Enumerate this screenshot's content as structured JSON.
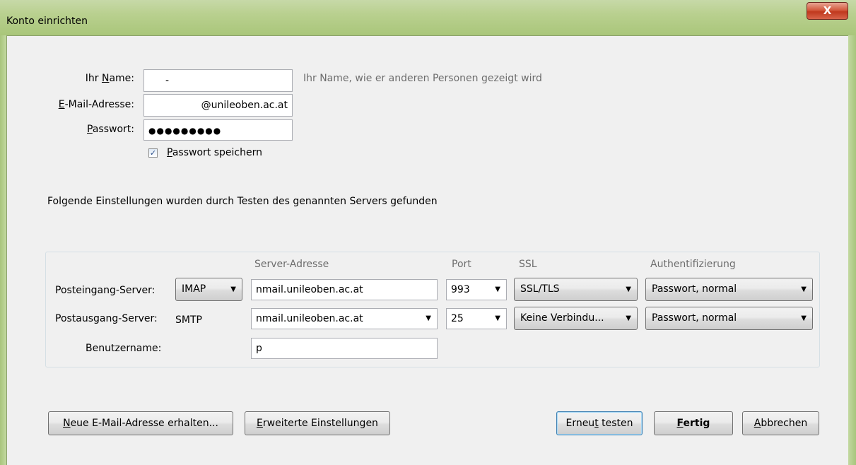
{
  "window": {
    "title": "Konto einrichten",
    "close_glyph": "X"
  },
  "form": {
    "name_label_pre": "Ihr ",
    "name_label_ul": "N",
    "name_label_post": "ame:",
    "name_value": "-",
    "name_hint": "Ihr Name, wie er anderen Personen gezeigt wird",
    "email_label_ul": "E",
    "email_label_post": "-Mail-Adresse:",
    "email_value": "@unileoben.ac.at",
    "password_label_ul": "P",
    "password_label_post": "asswort:",
    "password_value": "●●●●●●●●●",
    "remember_checked": true,
    "remember_check_glyph": "✓",
    "remember_label_ul": "P",
    "remember_label_post": "asswort speichern"
  },
  "found_text": "Folgende Einstellungen wurden durch Testen des genannten Servers gefunden",
  "server_table": {
    "headers": {
      "server": "Server-Adresse",
      "port": "Port",
      "ssl": "SSL",
      "auth": "Authentifizierung"
    },
    "incoming": {
      "label": "Posteingang-Server:",
      "protocol": "IMAP",
      "server": "nmail.unileoben.ac.at",
      "port": "993",
      "ssl": "SSL/TLS",
      "auth": "Passwort, normal"
    },
    "outgoing": {
      "label": "Postausgang-Server:",
      "protocol": "SMTP",
      "server": "nmail.unileoben.ac.at",
      "port": "25",
      "ssl": "Keine Verbindu...",
      "auth": "Passwort, normal"
    },
    "username": {
      "label": "Benutzername:",
      "value": "p"
    }
  },
  "buttons": {
    "new_email_ul": "N",
    "new_email_post": "eue E-Mail-Adresse erhalten...",
    "advanced_ul": "E",
    "advanced_post": "rweiterte Einstellungen",
    "retest_pre": "Erneu",
    "retest_ul": "t",
    "retest_post": " testen",
    "done_ul": "F",
    "done_post": "ertig",
    "cancel_ul": "A",
    "cancel_post": "bbrechen"
  },
  "icons": {
    "dropdown_arrow": "▼",
    "close": "close-icon",
    "checkbox": "checkmark-icon"
  }
}
